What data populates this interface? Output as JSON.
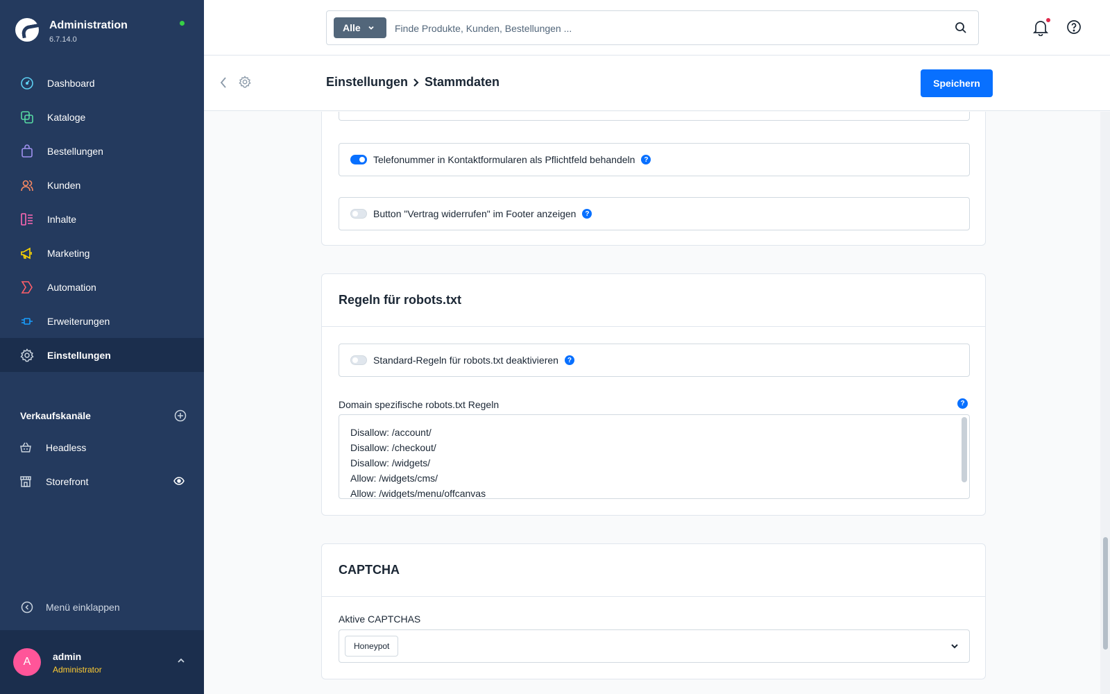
{
  "app": {
    "title": "Administration",
    "version": "6.7.14.0",
    "colors": {
      "sidebar": "#243a5e",
      "accent": "#0870ff",
      "status_online": "#37d046"
    }
  },
  "sidebar": {
    "items": [
      {
        "label": "Dashboard",
        "icon": "dashboard-icon"
      },
      {
        "label": "Kataloge",
        "icon": "catalog-icon"
      },
      {
        "label": "Bestellungen",
        "icon": "shopping-bag-icon"
      },
      {
        "label": "Kunden",
        "icon": "users-icon"
      },
      {
        "label": "Inhalte",
        "icon": "content-icon"
      },
      {
        "label": "Marketing",
        "icon": "megaphone-icon"
      },
      {
        "label": "Automation",
        "icon": "automation-icon"
      },
      {
        "label": "Erweiterungen",
        "icon": "plugin-icon"
      },
      {
        "label": "Einstellungen",
        "icon": "gear-icon",
        "active": true
      }
    ],
    "sales_channels_label": "Verkaufskanäle",
    "sales_channels": [
      {
        "label": "Headless",
        "icon": "basket-icon"
      },
      {
        "label": "Storefront",
        "icon": "storefront-icon"
      }
    ],
    "collapse_label": "Menü einklappen",
    "user": {
      "initial": "A",
      "name": "admin",
      "role": "Administrator"
    }
  },
  "topbar": {
    "search_type": "Alle",
    "search_placeholder": "Finde Produkte, Kunden, Bestellungen ..."
  },
  "smartbar": {
    "breadcrumb_parent": "Einstellungen",
    "breadcrumb_current": "Stammdaten",
    "save_label": "Speichern"
  },
  "main": {
    "phone_required_label": "Telefonummer in Kontaktformularen als Pflichtfeld behandeln",
    "phone_required_on": true,
    "revoke_button_label": "Button \"Vertrag widerrufen\" im Footer anzeigen",
    "revoke_button_on": false,
    "robots_card": {
      "title": "Regeln für robots.txt",
      "disable_default_label": "Standard-Regeln für robots.txt deaktivieren",
      "disable_default_on": false,
      "domain_rules_label": "Domain spezifische robots.txt Regeln",
      "rules": [
        "Disallow: /account/",
        "Disallow: /checkout/",
        "Disallow: /widgets/",
        "Allow: /widgets/cms/",
        "Allow: /widgets/menu/offcanvas"
      ]
    },
    "captcha_card": {
      "title": "CAPTCHA",
      "active_label": "Aktive CAPTCHAS",
      "selected": [
        "Honeypot"
      ]
    }
  }
}
